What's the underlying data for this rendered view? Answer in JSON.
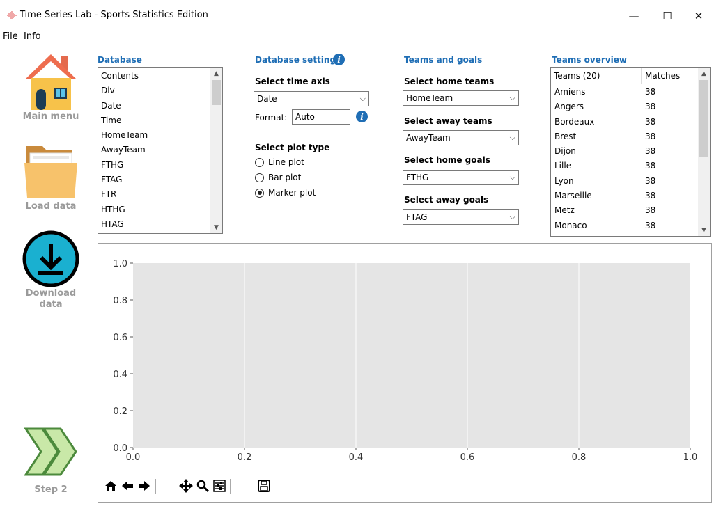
{
  "window": {
    "title": "Time Series Lab - Sports Statistics Edition",
    "minimize": "—",
    "maximize": "☐",
    "close": "✕"
  },
  "menu": {
    "file": "File",
    "info": "Info"
  },
  "nav": {
    "main_menu": "Main menu",
    "load_data": "Load data",
    "download_data_1": "Download",
    "download_data_2": "data",
    "step2": "Step 2"
  },
  "database": {
    "title": "Database",
    "items": [
      "Contents",
      "Div",
      "Date",
      "Time",
      "HomeTeam",
      "AwayTeam",
      "FTHG",
      "FTAG",
      "FTR",
      "HTHG",
      "HTAG"
    ]
  },
  "database_settings": {
    "title": "Database settings",
    "time_axis_label": "Select time axis",
    "time_axis_value": "Date",
    "format_label": "Format:",
    "format_value": "Auto",
    "plot_type_label": "Select plot type",
    "plot_types": [
      {
        "label": "Line plot",
        "selected": false
      },
      {
        "label": "Bar plot",
        "selected": false
      },
      {
        "label": "Marker plot",
        "selected": true
      }
    ]
  },
  "teams_goals": {
    "title": "Teams and goals",
    "home_teams_label": "Select home teams",
    "home_teams_value": "HomeTeam",
    "away_teams_label": "Select away teams",
    "away_teams_value": "AwayTeam",
    "home_goals_label": "Select home goals",
    "home_goals_value": "FTHG",
    "away_goals_label": "Select away goals",
    "away_goals_value": "FTAG"
  },
  "teams_overview": {
    "title": "Teams overview",
    "col_teams": "Teams (20)",
    "col_matches": "Matches",
    "rows": [
      {
        "team": "Amiens",
        "matches": "38"
      },
      {
        "team": "Angers",
        "matches": "38"
      },
      {
        "team": "Bordeaux",
        "matches": "38"
      },
      {
        "team": "Brest",
        "matches": "38"
      },
      {
        "team": "Dijon",
        "matches": "38"
      },
      {
        "team": "Lille",
        "matches": "38"
      },
      {
        "team": "Lyon",
        "matches": "38"
      },
      {
        "team": "Marseille",
        "matches": "38"
      },
      {
        "team": "Metz",
        "matches": "38"
      },
      {
        "team": "Monaco",
        "matches": "38"
      }
    ]
  },
  "chart_data": {
    "type": "scatter",
    "title": "",
    "xlabel": "",
    "ylabel": "",
    "xlim": [
      0.0,
      1.0
    ],
    "ylim": [
      0.0,
      1.0
    ],
    "x_ticks": [
      "0.0",
      "0.2",
      "0.4",
      "0.6",
      "0.8",
      "1.0"
    ],
    "y_ticks": [
      "0.0",
      "0.2",
      "0.4",
      "0.6",
      "0.8",
      "1.0"
    ],
    "grid": true,
    "series": [],
    "background": "#e5e5e5"
  },
  "colors": {
    "accent": "#1f6eb5",
    "nav_label": "#9a9a9a",
    "download_circle": "#1ab0d0",
    "step_arrow": "#c9e8a8"
  },
  "toolbar_icons": [
    "home-icon",
    "back-icon",
    "forward-icon",
    "pan-icon",
    "zoom-icon",
    "configure-icon",
    "save-icon"
  ]
}
